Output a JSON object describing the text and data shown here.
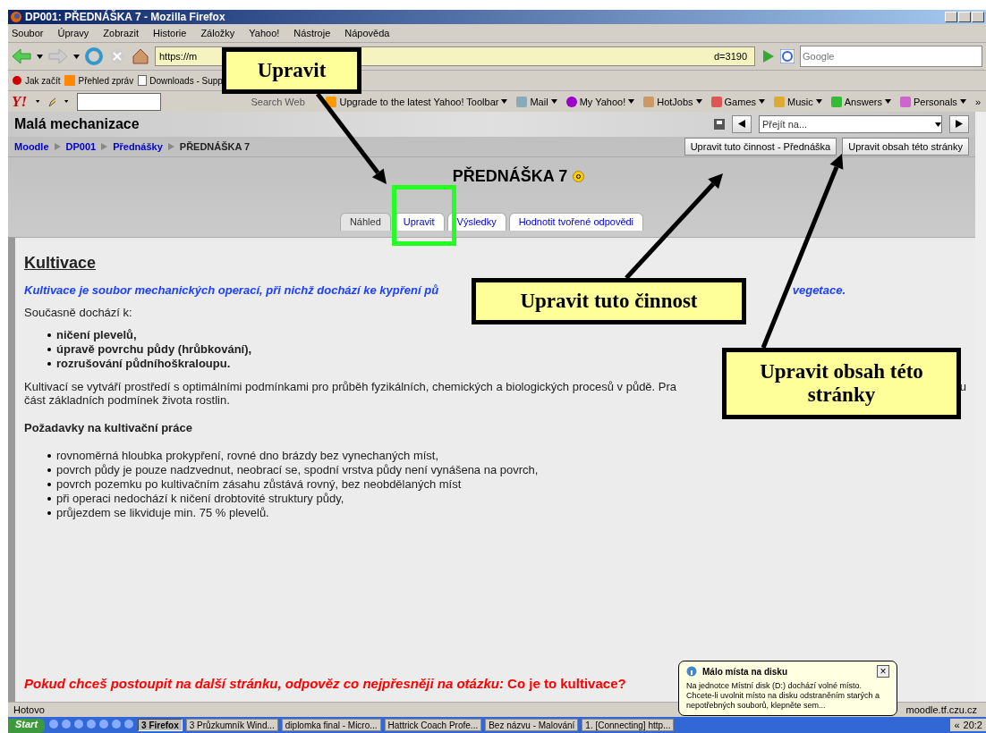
{
  "window": {
    "title": "DP001: PŘEDNÁŠKA 7 - Mozilla Firefox"
  },
  "menu": [
    "Soubor",
    "Úpravy",
    "Zobrazit",
    "Historie",
    "Záložky",
    "Yahoo!",
    "Nástroje",
    "Nápověda"
  ],
  "address_bar": {
    "url_start": "https://m",
    "url_end": "d=3190"
  },
  "search": {
    "placeholder": "Google"
  },
  "bookmarks": [
    "Jak začít",
    "Přehled zpráv",
    "Downloads - Supp"
  ],
  "yahoo_toolbar": {
    "logo": "Y!",
    "search_button": "Search Web",
    "items": [
      "Upgrade to the latest Yahoo! Toolbar",
      "Mail",
      "My Yahoo!",
      "HotJobs",
      "Games",
      "Music",
      "Answers",
      "Personals"
    ],
    "more": "»"
  },
  "moodle": {
    "site_title": "Malá mechanizace",
    "jump": {
      "placeholder": "Přejít na..."
    },
    "breadcrumb": [
      "Moodle",
      "DP001",
      "Přednášky",
      "PŘEDNÁŠKA 7"
    ],
    "buttons": [
      "Upravit tuto činnost - Přednáška",
      "Upravit obsah této stránky"
    ],
    "heading": "PŘEDNÁŠKA 7",
    "tabs": [
      {
        "label": "Náhled",
        "selected": true
      },
      {
        "label": "Upravit",
        "selected": false
      },
      {
        "label": "Výsledky",
        "selected": false
      },
      {
        "label": "Hodnotit tvořené odpovědi",
        "selected": false
      }
    ]
  },
  "content": {
    "title": "Kultivace",
    "lead_start": "Kultivace je soubor mechanických operací, při nichž dochází ke kypření pů",
    "lead_end": "vegetace.",
    "intro": "Současně dochází k:",
    "bold_list": [
      "ničení plevelů,",
      "úpravě povrchu půdy (hrůbkování),",
      "rozrušování půdníhoškraloupu."
    ],
    "para_start": "Kultivací se vytváří prostředí s optimálními podmínkami pro průběh fyzikálních, chemických a biologických procesů v půdě. Pra",
    "para_end": "u",
    "para_line2": "část základních podmínek života rostlin.",
    "subheading": "Požadavky na kultivační práce",
    "list": [
      "rovnoměrná hloubka prokypření, rovné dno brázdy bez vynechaných míst,",
      "povrch půdy je pouze nadzvednut, neobrací se, spodní vrstva půdy není vynášena na povrch,",
      "povrch pozemku po kultivačním zásahu zůstává rovný, bez neobdělaných míst",
      "při operaci nedochází k ničení drobtovité struktury půdy,",
      "průjezdem se likviduje min. 75 % plevelů."
    ],
    "question": "Pokud chceš postoupit na další stránku, odpověz co nejpřesněji na otázku:",
    "question_bold": "Co je to kultivace?"
  },
  "status_bar": {
    "text": "Hotovo",
    "host": "moodle.tf.czu.cz"
  },
  "notification": {
    "title": "Málo místa na disku",
    "close": "×",
    "body": "Na jednotce Místní disk (D:) dochází volné místo. Chcete-li uvolnit místo na disku odstraněním starých a nepotřebných souborů, klepněte sem..."
  },
  "taskbar": {
    "start": "Start",
    "tasks": [
      {
        "label": "3 Firefox",
        "selected": true
      },
      {
        "label": "3 Průzkumník Wind...",
        "selected": false
      },
      {
        "label": "diplomka final - Micro...",
        "selected": false
      },
      {
        "label": "Hattrick Coach Profe...",
        "selected": false
      },
      {
        "label": "Bez názvu - Malování",
        "selected": false
      },
      {
        "label": "1. [Connecting] http...",
        "selected": false
      }
    ],
    "tray_more": "«",
    "clock": "20:2"
  },
  "callouts": [
    "Upravit",
    "Upravit tuto činnost",
    "Upravit obsah této stránky"
  ]
}
